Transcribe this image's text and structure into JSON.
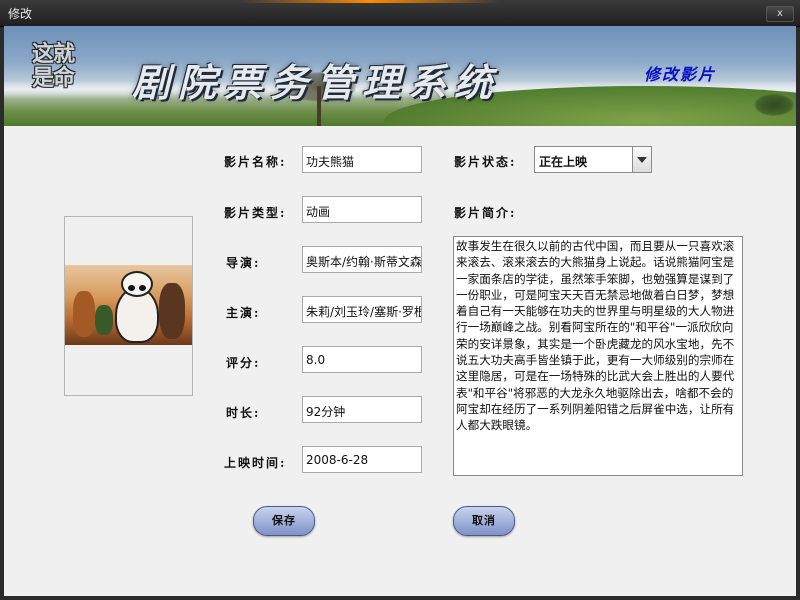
{
  "window": {
    "title": "修改",
    "close_label": "x"
  },
  "banner": {
    "logo_line1": "这就",
    "logo_line2": "是命",
    "app_title": "剧院票务管理系统",
    "subtitle": "修改影片"
  },
  "form": {
    "name_label": "影片名称:",
    "name_value": "功夫熊猫",
    "type_label": "影片类型:",
    "type_value": "动画",
    "director_label": "导演:",
    "director_value": "奥斯本/约翰·斯蒂文森",
    "actor_label": "主演:",
    "actor_value": "朱莉/刘玉玲/塞斯·罗根",
    "rating_label": "评分:",
    "rating_value": "8.0",
    "duration_label": "时长:",
    "duration_value": "92分钟",
    "release_label": "上映时间:",
    "release_value": "2008-6-28",
    "status_label": "影片状态:",
    "status_value": "正在上映",
    "desc_label": "影片简介:",
    "desc_value": "故事发生在很久以前的古代中国，而且要从一只喜欢滚来滚去、滚来滚去的大熊猫身上说起。话说熊猫阿宝是一家面条店的学徒，虽然笨手笨脚，也勉强算是谋到了一份职业，可是阿宝天天百无禁忌地做着白日梦，梦想着自己有一天能够在功夫的世界里与明星级的大人物进行一场巅峰之战。别看阿宝所在的\"和平谷\"一派欣欣向荣的安详景象，其实是一个卧虎藏龙的风水宝地，先不说五大功夫高手皆坐镇于此，更有一大师级别的宗师在这里隐居，可是在一场特殊的比武大会上胜出的人要代表\"和平谷\"将邪恶的大龙永久地驱除出去，啥都不会的阿宝却在经历了一系列阴差阳错之后屏雀中选，让所有人都大跌眼镜。"
  },
  "buttons": {
    "save": "保存",
    "cancel": "取消"
  },
  "poster": {
    "alt": "kung-fu-panda-poster"
  }
}
